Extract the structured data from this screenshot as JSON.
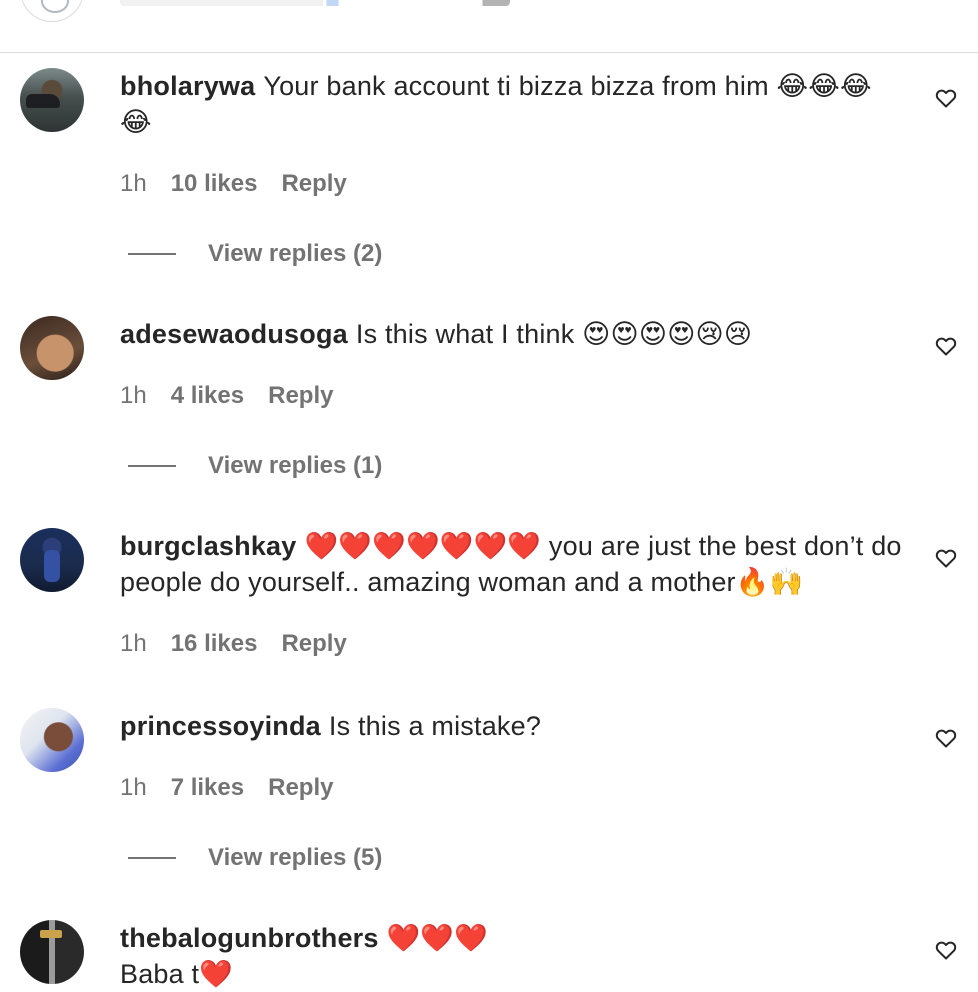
{
  "comments": [
    {
      "username": "bholarywa",
      "text": "Your bank account ti bizza bizza from him 😂😂😂",
      "text2": "😂",
      "time": "1h",
      "likes": "10 likes",
      "reply": "Reply",
      "view_replies": "View replies (2)"
    },
    {
      "username": "adesewaodusoga",
      "text": "Is this what I think 😍😍😍😍😢😢",
      "time": "1h",
      "likes": "4 likes",
      "reply": "Reply",
      "view_replies": "View replies (1)"
    },
    {
      "username": "burgclashkay",
      "text": "❤️❤️❤️❤️❤️❤️❤️ you are just the best don’t do",
      "text2": "people do yourself.. amazing woman and a mother🔥🙌",
      "time": "1h",
      "likes": "16 likes",
      "reply": "Reply"
    },
    {
      "username": "princessoyinda",
      "text": "Is this a mistake?",
      "time": "1h",
      "likes": "7 likes",
      "reply": "Reply",
      "view_replies": "View replies (5)"
    },
    {
      "username": "thebalogunbrothers",
      "text": "❤️❤️❤️",
      "text2": "Baba t❤️"
    }
  ],
  "colors": {
    "text": "#262626",
    "muted": "#737373",
    "divider": "#dbdbdb"
  },
  "icons": {
    "like": "heart-outline-icon"
  }
}
